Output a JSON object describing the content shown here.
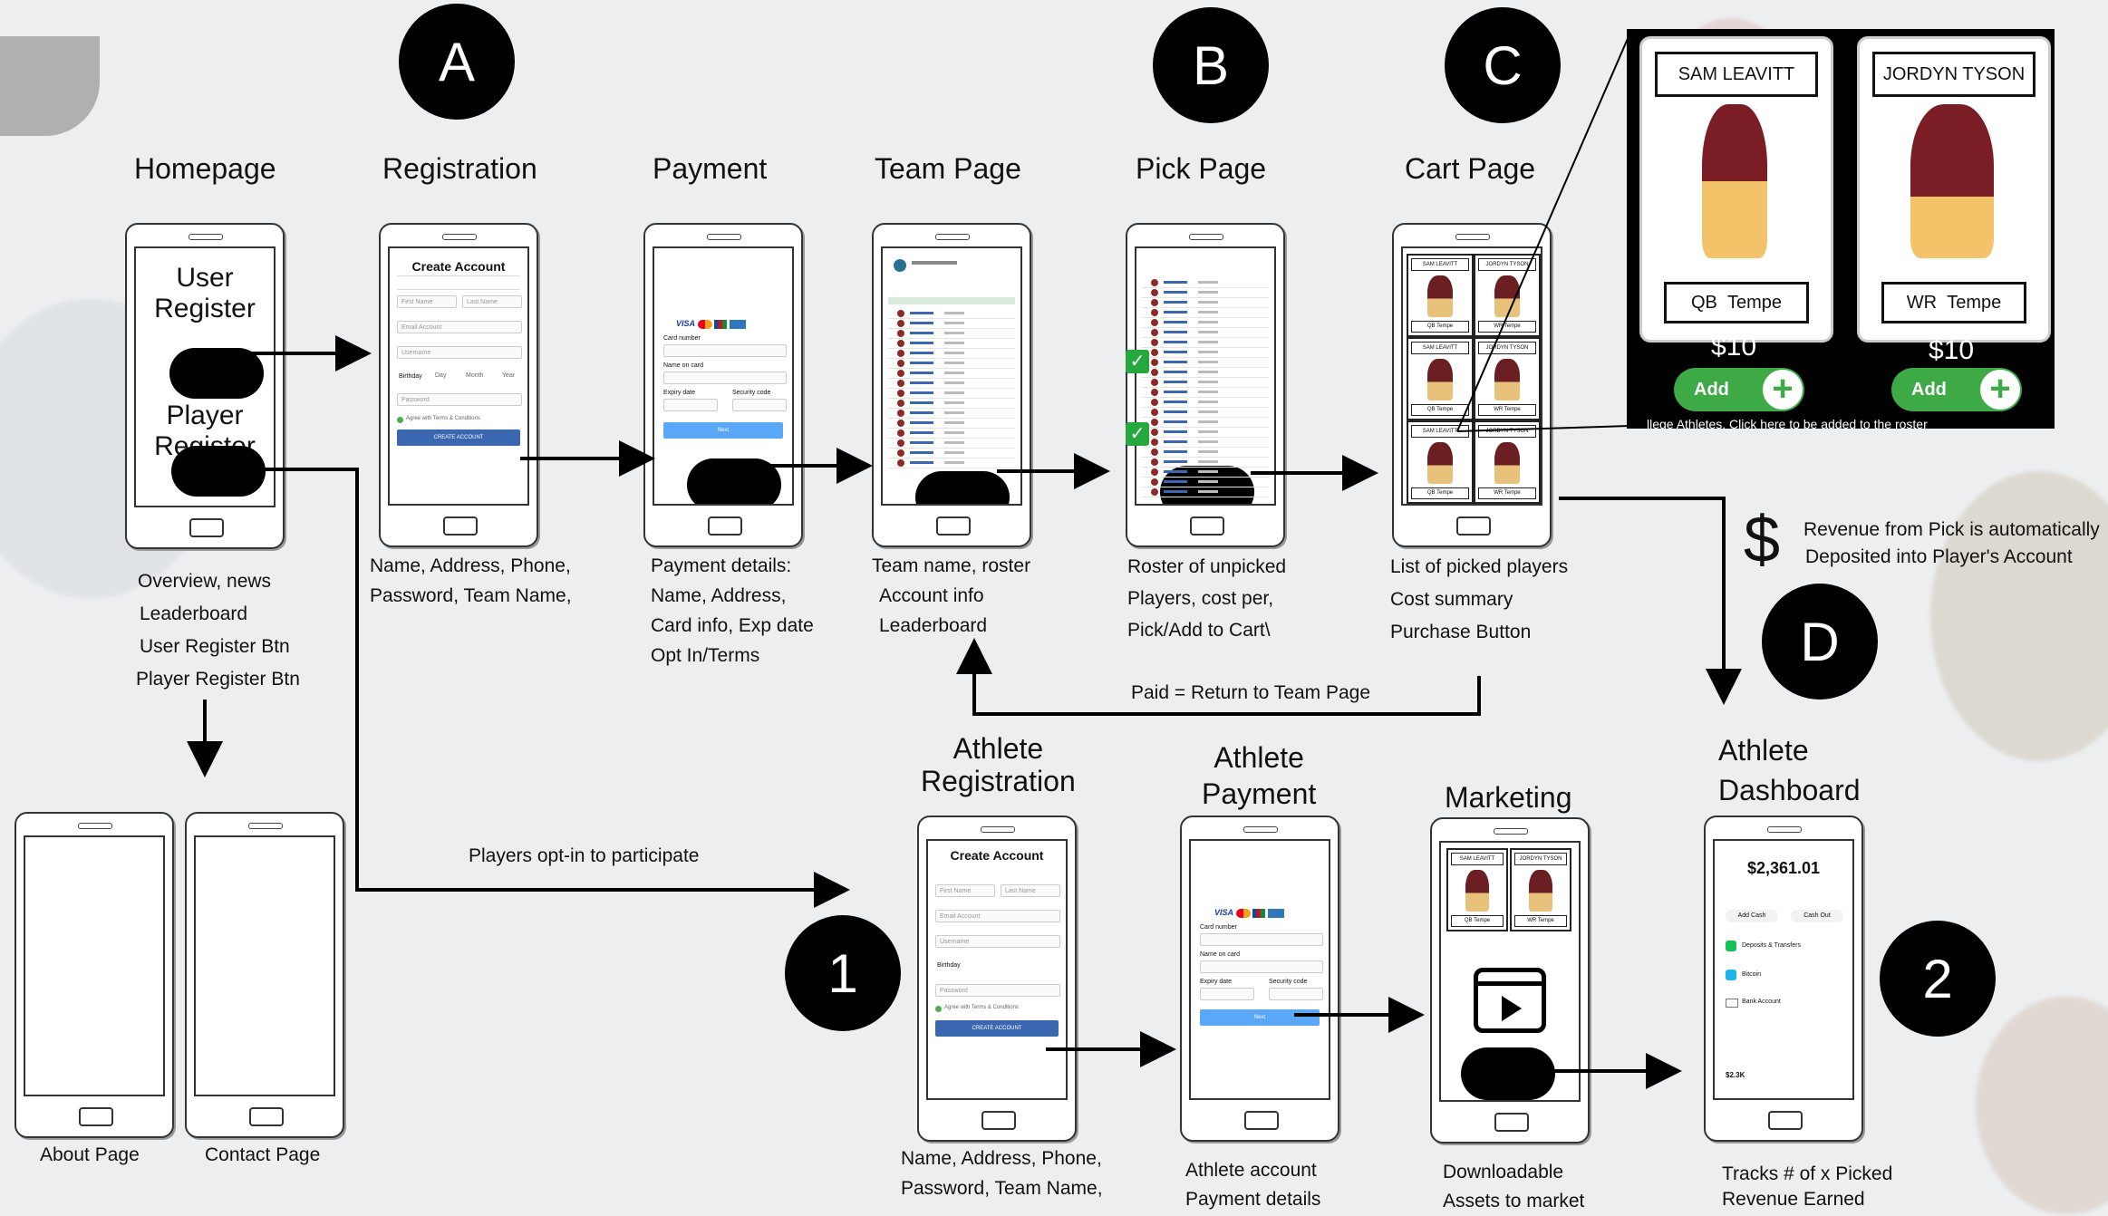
{
  "badges": {
    "a": "A",
    "b": "B",
    "c": "C",
    "d": "D",
    "one": "1",
    "two": "2"
  },
  "headings": {
    "homepage": "Homepage",
    "registration": "Registration",
    "payment": "Payment",
    "team_page": "Team Page",
    "pick_page": "Pick Page",
    "cart_page": "Cart Page",
    "athlete_registration_1": "Athlete",
    "athlete_registration_2": "Registration",
    "athlete_payment_1": "Athlete",
    "athlete_payment_2": "Payment",
    "marketing": "Marketing",
    "athlete_dashboard_1": "Athlete",
    "athlete_dashboard_2": "Dashboard"
  },
  "homepage_phone": {
    "user_register": "User Register",
    "player_register": "Player Register"
  },
  "captions": {
    "homepage": [
      "Overview, news",
      "Leaderboard",
      "User Register Btn",
      "Player Register Btn"
    ],
    "registration": [
      "Name, Address, Phone,",
      "Password, Team Name,"
    ],
    "payment": [
      "Payment details:",
      "Name, Address,",
      "Card info, Exp date",
      "Opt In/Terms"
    ],
    "team_page": [
      "Team name, roster",
      "Account info",
      "Leaderboard"
    ],
    "pick_page": [
      "Roster of unpicked",
      "Players, cost per,",
      "Pick/Add to Cart\\"
    ],
    "cart_page": [
      "List of picked players",
      "Cost summary",
      "Purchase Button"
    ],
    "about": "About Page",
    "contact": "Contact Page",
    "athlete_registration": [
      "Name, Address, Phone,",
      "Password, Team Name,"
    ],
    "athlete_payment": [
      "Athlete  account",
      "Payment details"
    ],
    "marketing": [
      "Downloadable",
      "Assets to market"
    ],
    "athlete_dashboard": [
      "Tracks # of x Picked",
      "Revenue Earned"
    ]
  },
  "flow_labels": {
    "paid_return": "Paid = Return to Team Page",
    "players_opt_in": "Players opt-in to participate",
    "revenue_line1": "Revenue from Pick is automatically",
    "revenue_line2": "Deposited into Player's Account",
    "dollar": "$"
  },
  "registration_form": {
    "title": "Create Account",
    "first_name": "First Name",
    "last_name": "Last Name",
    "email": "Email Account",
    "username": "Username",
    "birthday": "Birthday",
    "day": "Day",
    "month": "Month",
    "year": "Year",
    "password": "Password",
    "agree": "Agree with Terms & Conditions",
    "button": "CREATE ACCOUNT"
  },
  "payment_form": {
    "card_number": "Card number",
    "name_on_card": "Name on card",
    "expiry": "Expiry date",
    "security": "Security code",
    "next": "Next"
  },
  "dashboard": {
    "balance": "$2,361.01",
    "add_cash": "Add Cash",
    "cash_out": "Cash Out",
    "items": [
      "Deposits & Transfers",
      "Bitcoin",
      "Bank Account"
    ],
    "footer_value": "$2.3K"
  },
  "zoom_cards": [
    {
      "name": "SAM LEAVITT",
      "position": "QB",
      "location": "Tempe",
      "price": "$10",
      "add": "Add",
      "jersey": "#6b1f22"
    },
    {
      "name": "JORDYN TYSON",
      "position": "WR",
      "location": "Tempe",
      "price": "$10",
      "add": "Add",
      "jersey": "#6b1f22"
    }
  ],
  "zoom_footer": "llege Athletes. Click here to be added to the roster",
  "colors": {
    "badge": "#000000",
    "add_green": "#3eaa45",
    "check_green": "#27a83f",
    "form_blue": "#3b66b0",
    "next_blue": "#5aa6f7"
  },
  "icons": [
    "check-icon",
    "plus-icon",
    "play-icon",
    "dollar-icon",
    "visa-icon",
    "mastercard-icon",
    "jcb-icon",
    "amex-icon"
  ]
}
